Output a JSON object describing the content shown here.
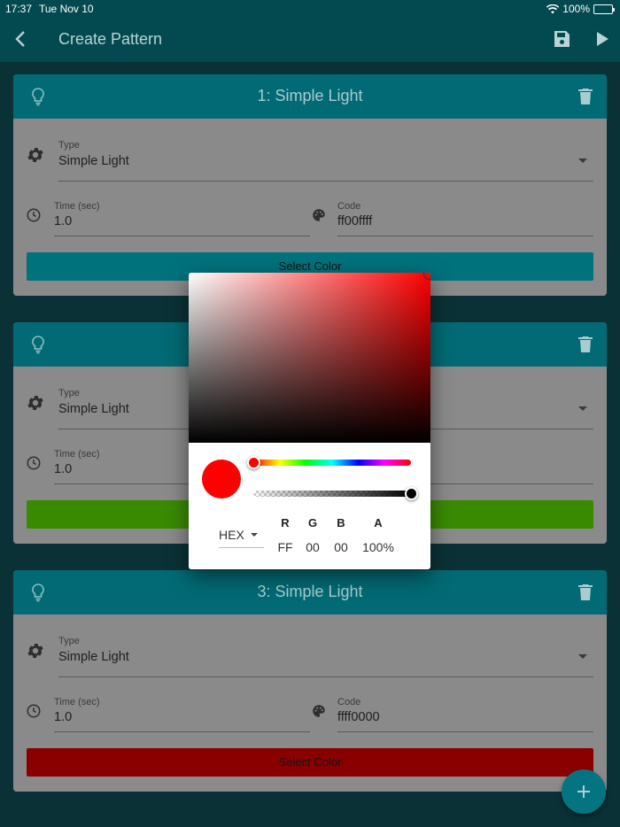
{
  "status_bar": {
    "time": "17:37",
    "date": "Tue Nov 10",
    "battery": "100%"
  },
  "app_bar": {
    "title": "Create Pattern"
  },
  "patterns": [
    {
      "title": "1: Simple Light",
      "type_label": "Type",
      "type_value": "Simple Light",
      "time_label": "Time (sec)",
      "time_value": "1.0",
      "code_label": "Code",
      "code_value": "ff00ffff",
      "select_label": "Select Color",
      "button_color": "#00727c"
    },
    {
      "title": "",
      "type_label": "Type",
      "type_value": "Simple Light",
      "time_label": "Time (sec)",
      "time_value": "1.0",
      "code_label": "",
      "code_value": "",
      "select_label": "",
      "button_color": "#3a8a00"
    },
    {
      "title": "3: Simple Light",
      "type_label": "Type",
      "type_value": "Simple Light",
      "time_label": "Time (sec)",
      "time_value": "1.0",
      "code_label": "Code",
      "code_value": "ffff0000",
      "select_label": "Select Color",
      "button_color": "#8a0000"
    }
  ],
  "color_picker": {
    "mode": "HEX",
    "channel_labels": [
      "R",
      "G",
      "B",
      "A"
    ],
    "channel_values": [
      "FF",
      "00",
      "00",
      "100%"
    ],
    "current_color": "#ff0000",
    "hue_color": "#ff0000",
    "hue_position": 0.0,
    "alpha_position": 1.0
  },
  "icons": {
    "back": "chevron-left-icon",
    "save": "save-icon",
    "play": "play-icon",
    "bulb": "lightbulb-icon",
    "trash": "trash-icon",
    "settings": "gear-icon",
    "clock": "clock-icon",
    "palette": "palette-icon",
    "add": "plus-icon"
  }
}
